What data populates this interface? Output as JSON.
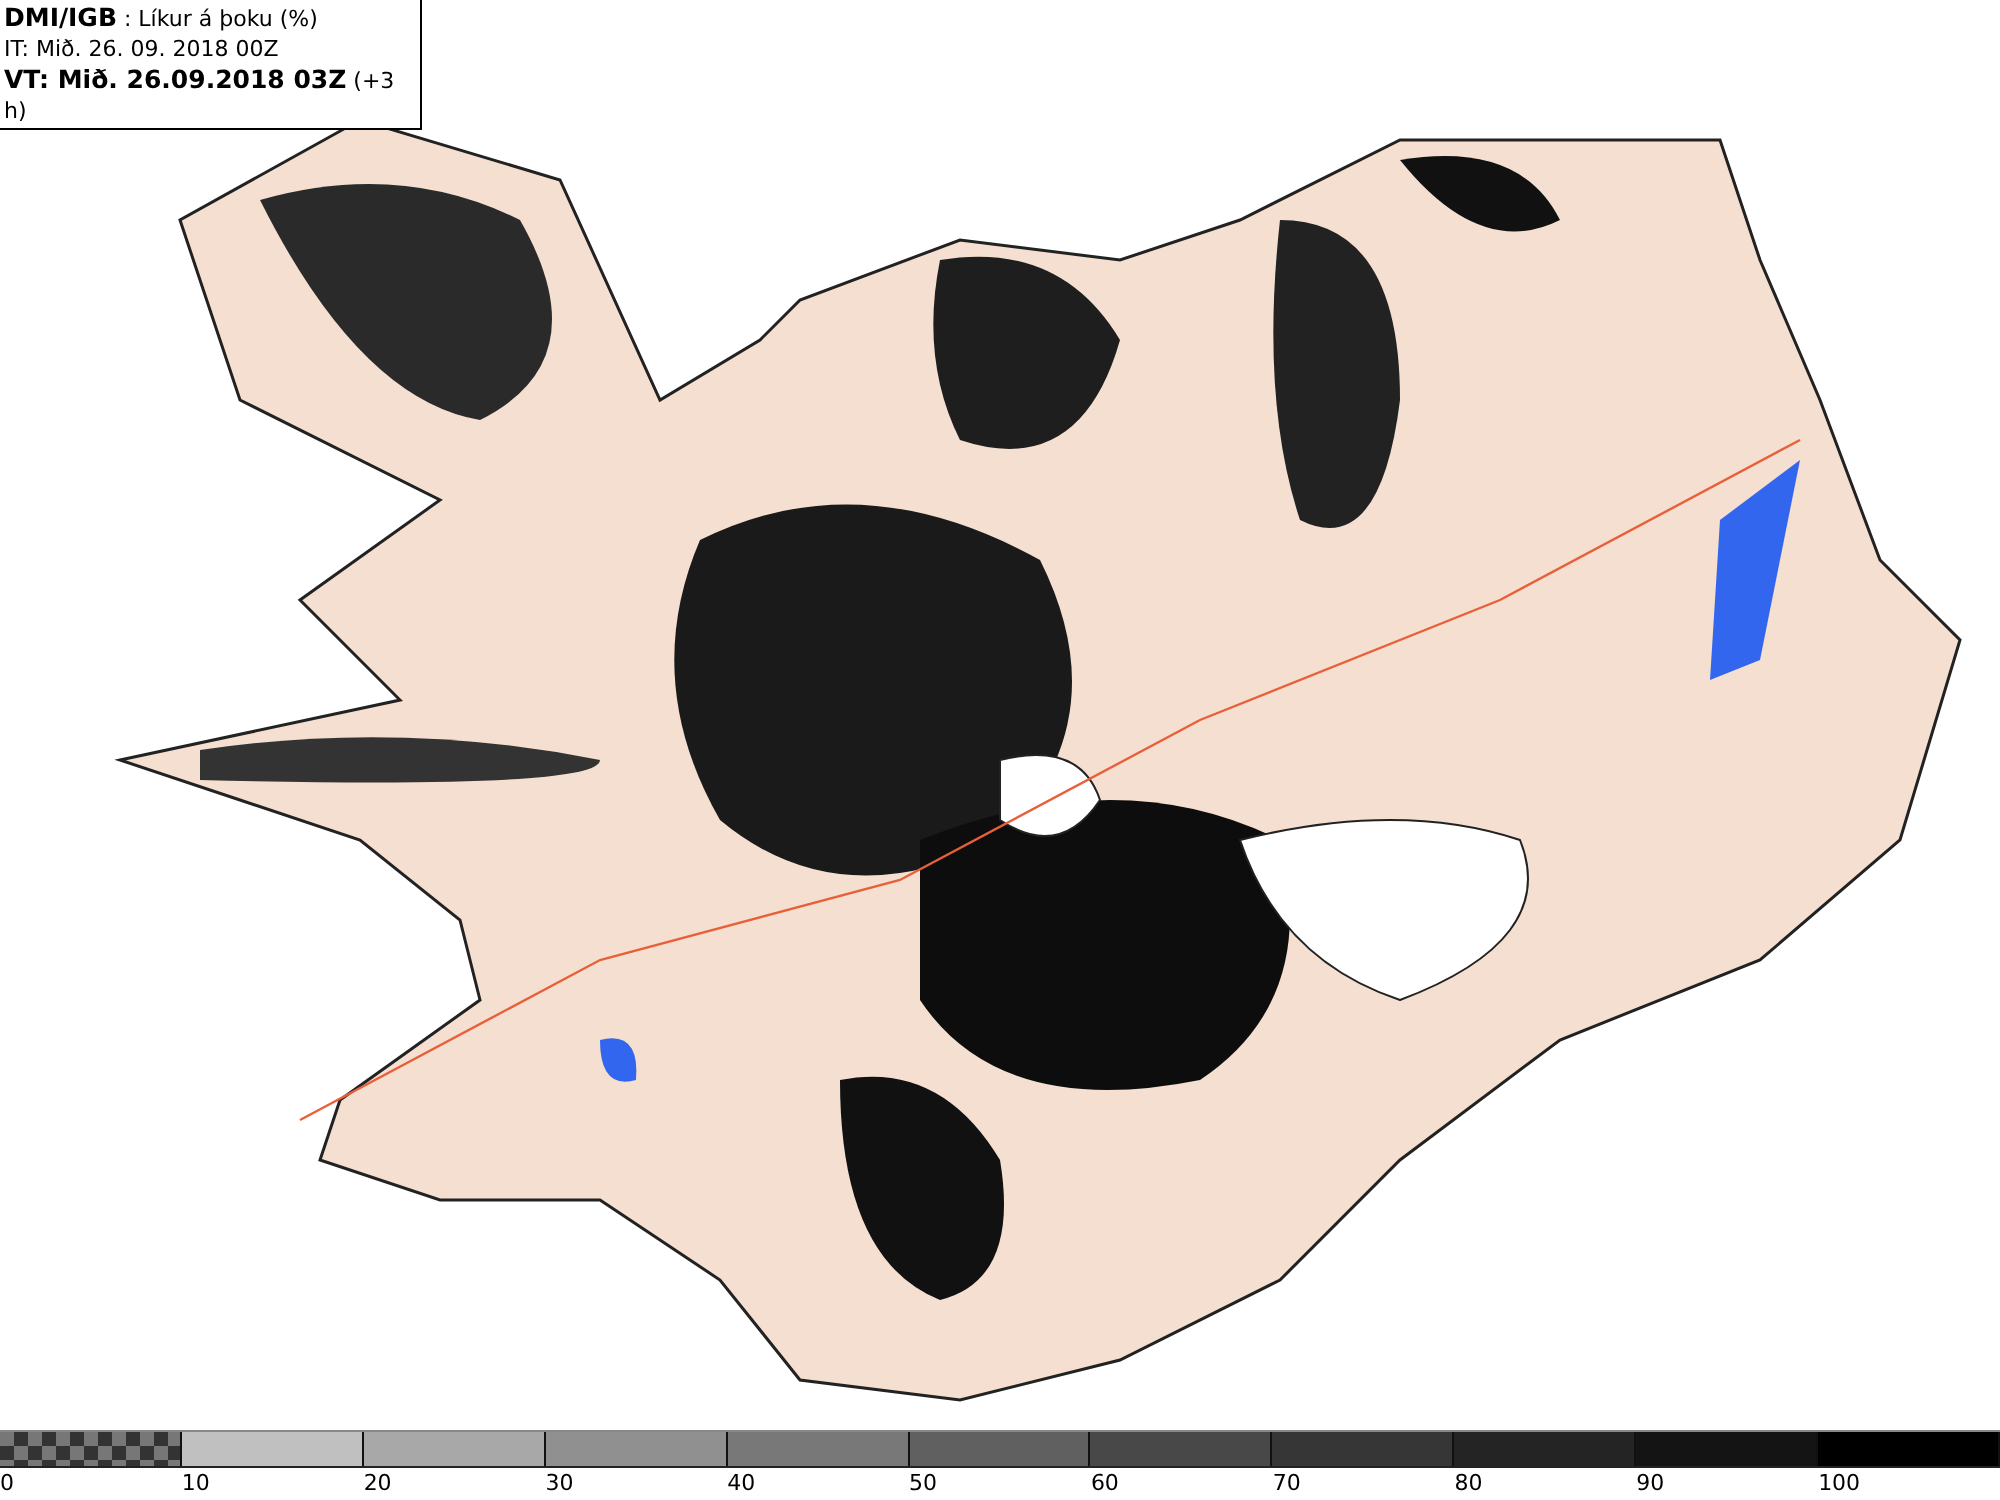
{
  "header": {
    "source": "DMI/IGB",
    "product": " : Líkur á þoku (%)",
    "issue_time": "IT: Mið. 26. 09. 2018 00Z",
    "valid_time": "VT: Mið. 26.09.2018 03Z",
    "offset": "(+3 h)"
  },
  "legend": [
    {
      "label": "0",
      "kind": "pattern"
    },
    {
      "label": "10",
      "kind": "solid",
      "color": "#c0c0c0"
    },
    {
      "label": "20",
      "kind": "solid",
      "color": "#a8a8a8"
    },
    {
      "label": "30",
      "kind": "solid",
      "color": "#909090"
    },
    {
      "label": "40",
      "kind": "solid",
      "color": "#787878"
    },
    {
      "label": "50",
      "kind": "solid",
      "color": "#606060"
    },
    {
      "label": "60",
      "kind": "solid",
      "color": "#484848"
    },
    {
      "label": "70",
      "kind": "solid",
      "color": "#363636"
    },
    {
      "label": "80",
      "kind": "solid",
      "color": "#242424"
    },
    {
      "label": "90",
      "kind": "solid",
      "color": "#141414"
    },
    {
      "label": "100",
      "kind": "solid",
      "color": "#000000"
    }
  ]
}
